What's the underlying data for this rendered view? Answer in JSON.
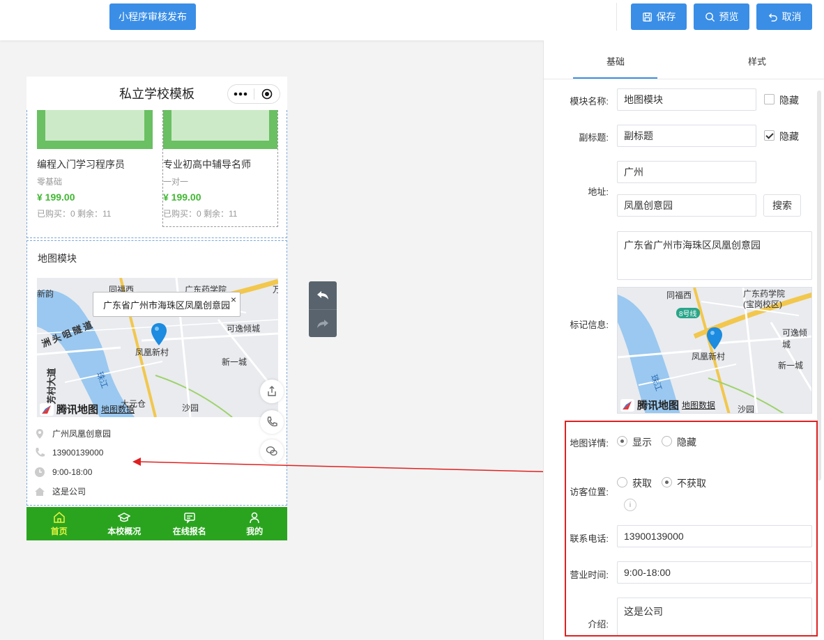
{
  "topbar": {
    "publish_label": "小程序审核发布",
    "save_label": "保存",
    "preview_label": "预览",
    "cancel_label": "取消"
  },
  "phone": {
    "title": "私立学校模板",
    "products": [
      {
        "name": "编程入门学习程序员",
        "subtitle": "零基础",
        "price": "¥ 199.00",
        "stats": "已购买：0 剩余：11"
      },
      {
        "name": "专业初高中辅导名师",
        "subtitle": "一对一",
        "price": "¥ 199.00",
        "stats": "已购买：0 剩余：11"
      }
    ],
    "map_block": {
      "title": "地图模块",
      "popup_address": "广东省广州市海珠区凤凰创意园",
      "popup_close": "×",
      "map_labels": {
        "tongfu": "同福西",
        "yaoxue": "广东药学院",
        "hui": "新韵",
        "fang": "万",
        "suidao": "洲头咀隧道",
        "keyi": "可逸倾城",
        "fenghuang": "凤凰新村",
        "xinyi": "新一城",
        "fangcun": "芳村大道",
        "zhujiang": "珠江",
        "dayuan": "大元仓",
        "shayuan": "沙园",
        "brand": "腾讯地图",
        "data": "地图数据"
      },
      "info": {
        "address": "广州凤凰创意园",
        "phone": "13900139000",
        "hours": "9:00-18:00",
        "intro": "这是公司"
      }
    },
    "tabbar": [
      {
        "label": "首页",
        "icon": "home-icon"
      },
      {
        "label": "本校概况",
        "icon": "graduation-cap-icon"
      },
      {
        "label": "在线报名",
        "icon": "message-icon"
      },
      {
        "label": "我的",
        "icon": "user-icon"
      }
    ]
  },
  "panel": {
    "tabs": [
      "基础",
      "样式"
    ],
    "module_name_label": "模块名称:",
    "module_name_value": "地图模块",
    "hide_label": "隐藏",
    "subtitle_label": "副标题:",
    "subtitle_value": "副标题",
    "address_label": "地址:",
    "city_value": "广州",
    "keyword_value": "凤凰创意园",
    "search_label": "搜索",
    "address_full": "广东省广州市海珠区凤凰创意园",
    "marker_label": "标记信息:",
    "marker_map_labels": {
      "tongfu": "同福西",
      "yaoxue1": "广东药学院",
      "yaoxue2": "(宝岗校区)",
      "line8": "8号线",
      "keyi": "可逸倾城",
      "fenghuang": "凤凰新村",
      "xinyi": "新一城",
      "zhujiang": "珠江",
      "shayuan": "沙园",
      "brand": "腾讯地图",
      "data": "地图数据"
    },
    "map_detail_label": "地图详情:",
    "show_label": "显示",
    "hide_option_label": "隐藏",
    "visitor_label": "访客位置:",
    "get_label": "获取",
    "noget_label": "不获取",
    "info_icon": "i",
    "phone_label": "联系电话:",
    "phone_value": "13900139000",
    "hours_label": "营业时间:",
    "hours_value": "9:00-18:00",
    "intro_label": "介绍:",
    "intro_value": "这是公司"
  },
  "colors": {
    "primary": "#3a8ee6",
    "tabbar": "#2aa41f",
    "price": "#40b832",
    "highlight": "#e02020"
  }
}
